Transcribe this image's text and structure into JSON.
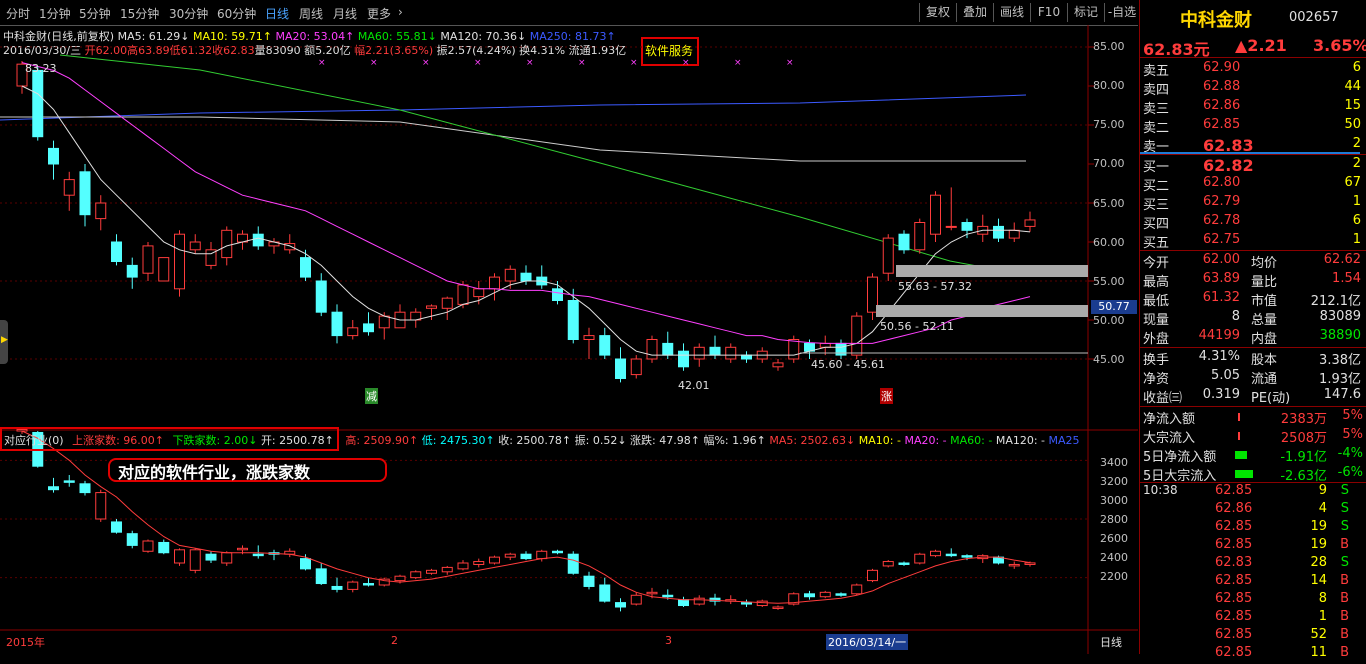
{
  "toolbar": {
    "tabs": [
      "分时",
      "1分钟",
      "5分钟",
      "15分钟",
      "30分钟",
      "60分钟",
      "日线",
      "周线",
      "月线",
      "更多"
    ],
    "active_tab": "日线",
    "buttons": [
      "复权",
      "叠加",
      "画线",
      "F10",
      "标记",
      "-自选"
    ]
  },
  "stock_info": {
    "name_line": "中科金财(日线,前复权)",
    "ma5": "MA5: 61.29↓",
    "ma10": "MA10: 59.71↑",
    "ma20": "MA20: 53.04↑",
    "ma60": "MA60: 55.81↓",
    "ma120": "MA120: 70.36↓",
    "ma250": "MA250: 81.73↑",
    "date": "2016/03/30/三",
    "open": "开62.00",
    "high": "高63.89",
    "low": "低61.32",
    "close": "收62.83",
    "volume": "量83090",
    "amount": "额5.20亿",
    "change": "幅2.21(3.65%)",
    "amplitude": "振2.57(4.24%)",
    "turnover": "换4.31%",
    "float": "流通1.93亿",
    "industry_tag": "软件服务"
  },
  "main_chart": {
    "y_ticks": [
      "85.00",
      "80.00",
      "75.00",
      "70.00",
      "65.00",
      "60.00",
      "55.00",
      "50.00",
      "45.00"
    ],
    "high_label": "83.23",
    "low_label": "42.01",
    "zone_labels": [
      "55.63 - 57.32",
      "50.56 - 52.11",
      "45.60 - 45.61"
    ],
    "price_marker": "50.77",
    "marker_down": "减",
    "marker_up": "涨"
  },
  "sub_info": {
    "label": "对应行业(0)",
    "up": "上涨家数: 96.00↑",
    "down": "下跌家数: 2.00↓",
    "open": "开: 2500.78↑",
    "high": "高: 2509.90↑",
    "low": "低: 2475.30↑",
    "close": "收: 2500.78↑",
    "amp": "振: 0.52↓",
    "change": "涨跌: 47.98↑",
    "pct": "幅%: 1.96↑",
    "ma5": "MA5: 2502.63↓",
    "ma10": "MA10: -",
    "ma20": "MA20: -",
    "ma60": "MA60: -",
    "ma120": "MA120: -",
    "ma250": "MA25"
  },
  "annotation": "对应的软件行业，涨跌家数",
  "sub_chart": {
    "y_ticks": [
      "3400",
      "3200",
      "3000",
      "2800",
      "2600",
      "2400",
      "2200"
    ]
  },
  "bottom_axis": {
    "labels": [
      "2015年",
      "2",
      "3",
      "2016/03/14/一"
    ],
    "period": "日线"
  },
  "quote_panel": {
    "title": "中科金财",
    "code": "002657",
    "price": "62.83元",
    "change": "▲2.21",
    "pct": "3.65%",
    "asks": [
      {
        "label": "卖五",
        "price": "62.90",
        "vol": "6"
      },
      {
        "label": "卖四",
        "price": "62.88",
        "vol": "44"
      },
      {
        "label": "卖三",
        "price": "62.86",
        "vol": "15"
      },
      {
        "label": "卖二",
        "price": "62.85",
        "vol": "50"
      },
      {
        "label": "卖一",
        "price": "62.83",
        "vol": "2"
      }
    ],
    "bids": [
      {
        "label": "买一",
        "price": "62.82",
        "vol": "2"
      },
      {
        "label": "买二",
        "price": "62.80",
        "vol": "67"
      },
      {
        "label": "买三",
        "price": "62.79",
        "vol": "1"
      },
      {
        "label": "买四",
        "price": "62.78",
        "vol": "6"
      },
      {
        "label": "买五",
        "price": "62.75",
        "vol": "1"
      }
    ],
    "stats": [
      {
        "l1": "今开",
        "v1": "62.00",
        "l2": "均价",
        "v2": "62.62"
      },
      {
        "l1": "最高",
        "v1": "63.89",
        "l2": "量比",
        "v2": "1.54"
      },
      {
        "l1": "最低",
        "v1": "61.32",
        "l2": "市值",
        "v2": "212.1亿"
      },
      {
        "l1": "现量",
        "v1": "8",
        "l2": "总量",
        "v2": "83089"
      },
      {
        "l1": "外盘",
        "v1": "44199",
        "l2": "内盘",
        "v2": "38890"
      }
    ],
    "stats2": [
      {
        "l1": "换手",
        "v1": "4.31%",
        "l2": "股本",
        "v2": "3.38亿"
      },
      {
        "l1": "净资",
        "v1": "5.05",
        "l2": "流通",
        "v2": "1.93亿"
      },
      {
        "l1": "收益㈢",
        "v1": "0.319",
        "l2": "PE(动)",
        "v2": "147.6"
      }
    ],
    "flows": [
      {
        "label": "净流入额",
        "value": "2383万",
        "pct": "5%",
        "bar": 0.02,
        "dir": "up"
      },
      {
        "label": "大宗流入",
        "value": "2508万",
        "pct": "5%",
        "bar": 0.02,
        "dir": "up"
      },
      {
        "label": "5日净流入额",
        "value": "-1.91亿",
        "pct": "-4%",
        "bar": 0.4,
        "dir": "down"
      },
      {
        "label": "5日大宗流入",
        "value": "-2.63亿",
        "pct": "-6%",
        "bar": 0.6,
        "dir": "down"
      }
    ],
    "time": "10:38",
    "ticks": [
      {
        "price": "62.85",
        "vol": "9",
        "bs": "S"
      },
      {
        "price": "62.86",
        "vol": "4",
        "bs": "S"
      },
      {
        "price": "62.85",
        "vol": "19",
        "bs": "S"
      },
      {
        "price": "62.85",
        "vol": "19",
        "bs": "B"
      },
      {
        "price": "62.83",
        "vol": "28",
        "bs": "S"
      },
      {
        "price": "62.85",
        "vol": "14",
        "bs": "B"
      },
      {
        "price": "62.85",
        "vol": "8",
        "bs": "B"
      },
      {
        "price": "62.85",
        "vol": "1",
        "bs": "B"
      },
      {
        "price": "62.85",
        "vol": "52",
        "bs": "B"
      },
      {
        "price": "62.85",
        "vol": "11",
        "bs": "B"
      }
    ]
  },
  "chart_data": {
    "type": "candlestick",
    "main": {
      "ohlc": [
        [
          80,
          83.2,
          79,
          82.8
        ],
        [
          82,
          82.5,
          73,
          73.5
        ],
        [
          72,
          73,
          68,
          70
        ],
        [
          66,
          69,
          64,
          68
        ],
        [
          69,
          70,
          62,
          63.5
        ],
        [
          63,
          66,
          61.5,
          65
        ],
        [
          60,
          61,
          57,
          57.5
        ],
        [
          57,
          58,
          54,
          55.5
        ],
        [
          56,
          60,
          55,
          59.5
        ],
        [
          55,
          58,
          55,
          58
        ],
        [
          54,
          61.5,
          53,
          61
        ],
        [
          59,
          61,
          58.5,
          60
        ],
        [
          57,
          60,
          56.5,
          59
        ],
        [
          58,
          62,
          57,
          61.5
        ],
        [
          60,
          61.5,
          59,
          61
        ],
        [
          61,
          62,
          59,
          59.5
        ],
        [
          59.5,
          60.5,
          58.5,
          60
        ],
        [
          59,
          61,
          58.5,
          59.8
        ],
        [
          58,
          59,
          55,
          55.5
        ],
        [
          55,
          56,
          50.5,
          51
        ],
        [
          51,
          52,
          47,
          48
        ],
        [
          48,
          50,
          47.5,
          49
        ],
        [
          49.5,
          51,
          48,
          48.5
        ],
        [
          49,
          51,
          47.5,
          50.5
        ],
        [
          49,
          52,
          49,
          51
        ],
        [
          50,
          51.5,
          49,
          51
        ],
        [
          51.5,
          52,
          50,
          51.8
        ],
        [
          51.5,
          53,
          50,
          52.8
        ],
        [
          52,
          55,
          51.5,
          54.5
        ],
        [
          53,
          55,
          52,
          54
        ],
        [
          54,
          56,
          52.5,
          55.5
        ],
        [
          55,
          57,
          54,
          56.5
        ],
        [
          56,
          57,
          54.5,
          55
        ],
        [
          55.5,
          57,
          54,
          54.5
        ],
        [
          54,
          55,
          52,
          52.5
        ],
        [
          52.5,
          54,
          47,
          47.5
        ],
        [
          47.5,
          49,
          45,
          48
        ],
        [
          48,
          49,
          45,
          45.5
        ],
        [
          45,
          46.5,
          42,
          42.5
        ],
        [
          43,
          45.5,
          42.5,
          45
        ],
        [
          45,
          48,
          44.5,
          47.5
        ],
        [
          47,
          48.5,
          45,
          45.5
        ],
        [
          46,
          47,
          43.5,
          44
        ],
        [
          45,
          47,
          44,
          46.5
        ],
        [
          46.5,
          48,
          45,
          45.5
        ],
        [
          45,
          47,
          44.5,
          46.5
        ],
        [
          45.5,
          46,
          44.5,
          45
        ],
        [
          45,
          46.5,
          44.5,
          46
        ],
        [
          44,
          45,
          43.5,
          44.5
        ],
        [
          45,
          48,
          44.5,
          47.5
        ],
        [
          47,
          47.5,
          45,
          46
        ],
        [
          46.5,
          48,
          45.5,
          47
        ],
        [
          47,
          47.5,
          45,
          45.5
        ],
        [
          45.5,
          51,
          45,
          50.5
        ],
        [
          51,
          56,
          50,
          55.5
        ],
        [
          56,
          61,
          55,
          60.5
        ],
        [
          61,
          61.5,
          58.5,
          59
        ],
        [
          59,
          63,
          58.5,
          62.5
        ],
        [
          61,
          66.5,
          60,
          66
        ],
        [
          62,
          67,
          61.5,
          62
        ],
        [
          62.5,
          63,
          60.5,
          61.5
        ],
        [
          61,
          63.5,
          60,
          62
        ],
        [
          62,
          63,
          60,
          60.5
        ],
        [
          60.5,
          62.5,
          60,
          61.5
        ],
        [
          62,
          63.89,
          61.32,
          62.83
        ]
      ],
      "ma5": [
        80,
        79,
        77,
        74,
        71,
        68,
        66,
        64,
        62,
        60,
        59,
        58.5,
        58.5,
        59.5,
        60,
        60.5,
        60,
        59.5,
        58.5,
        57,
        55,
        53,
        51.5,
        50.5,
        50,
        50,
        50.5,
        51,
        52,
        52.5,
        53.5,
        54.5,
        55,
        55,
        54.5,
        53,
        51.5,
        49.5,
        47.5,
        46,
        45.5,
        45.5,
        45.5,
        45.5,
        45.5,
        45.5,
        45.5,
        45.5,
        45.5,
        45.5,
        46,
        46.5,
        46.5,
        47,
        48.5,
        51,
        53.5,
        56,
        58.5,
        60,
        61,
        61.5,
        61.5,
        61.5,
        61.3
      ],
      "ma20": [
        83,
        82.5,
        82,
        81,
        79.5,
        78,
        76.5,
        75,
        73.5,
        72,
        70.5,
        69,
        68,
        67,
        66,
        65.5,
        65,
        64.5,
        64,
        63,
        62,
        61,
        60,
        59,
        58,
        57,
        56,
        55,
        54.5,
        54,
        54,
        53.8,
        53.8,
        53.8,
        53.5,
        53.2,
        53,
        52.5,
        52,
        51.5,
        51,
        50.5,
        50,
        49.5,
        49,
        48.5,
        48,
        48,
        47.5,
        47.3,
        47.1,
        47,
        47,
        47,
        47,
        47.5,
        48,
        48.5,
        49,
        50,
        50.5,
        51.5,
        52,
        52.5,
        53
      ]
    },
    "sub": {
      "ohlc": [
        [
          3400,
          3420,
          3380,
          3410
        ],
        [
          3390,
          3400,
          3150,
          3160
        ],
        [
          3020,
          3080,
          2980,
          3000
        ],
        [
          3060,
          3100,
          3020,
          3050
        ],
        [
          3040,
          3060,
          2960,
          2980
        ],
        [
          2800,
          3000,
          2780,
          2980
        ],
        [
          2780,
          2800,
          2700,
          2710
        ],
        [
          2700,
          2720,
          2600,
          2620
        ],
        [
          2580,
          2660,
          2570,
          2650
        ],
        [
          2640,
          2660,
          2560,
          2570
        ],
        [
          2500,
          2600,
          2480,
          2590
        ],
        [
          2450,
          2600,
          2430,
          2590
        ],
        [
          2560,
          2580,
          2500,
          2520
        ],
        [
          2500,
          2580,
          2480,
          2570
        ],
        [
          2590,
          2620,
          2560,
          2600
        ],
        [
          2560,
          2620,
          2530,
          2550
        ],
        [
          2570,
          2590,
          2520,
          2560
        ],
        [
          2560,
          2600,
          2540,
          2580
        ],
        [
          2530,
          2560,
          2450,
          2460
        ],
        [
          2460,
          2500,
          2350,
          2360
        ],
        [
          2340,
          2400,
          2300,
          2320
        ],
        [
          2320,
          2380,
          2300,
          2370
        ],
        [
          2360,
          2400,
          2340,
          2350
        ],
        [
          2350,
          2400,
          2340,
          2390
        ],
        [
          2380,
          2420,
          2360,
          2410
        ],
        [
          2400,
          2450,
          2390,
          2440
        ],
        [
          2430,
          2460,
          2420,
          2450
        ],
        [
          2440,
          2480,
          2420,
          2470
        ],
        [
          2460,
          2520,
          2450,
          2500
        ],
        [
          2490,
          2530,
          2470,
          2510
        ],
        [
          2500,
          2550,
          2490,
          2540
        ],
        [
          2540,
          2570,
          2520,
          2560
        ],
        [
          2560,
          2580,
          2520,
          2530
        ],
        [
          2530,
          2590,
          2510,
          2580
        ],
        [
          2580,
          2590,
          2560,
          2570
        ],
        [
          2560,
          2580,
          2420,
          2430
        ],
        [
          2410,
          2440,
          2320,
          2340
        ],
        [
          2350,
          2400,
          2230,
          2240
        ],
        [
          2230,
          2260,
          2170,
          2200
        ],
        [
          2220,
          2300,
          2210,
          2280
        ],
        [
          2290,
          2330,
          2260,
          2300
        ],
        [
          2280,
          2320,
          2250,
          2270
        ],
        [
          2250,
          2270,
          2200,
          2210
        ],
        [
          2220,
          2280,
          2210,
          2260
        ],
        [
          2260,
          2290,
          2210,
          2240
        ],
        [
          2240,
          2280,
          2220,
          2250
        ],
        [
          2230,
          2250,
          2200,
          2220
        ],
        [
          2210,
          2250,
          2200,
          2240
        ],
        [
          2190,
          2210,
          2180,
          2200
        ],
        [
          2220,
          2300,
          2210,
          2290
        ],
        [
          2290,
          2310,
          2250,
          2270
        ],
        [
          2270,
          2310,
          2260,
          2300
        ],
        [
          2290,
          2300,
          2270,
          2280
        ],
        [
          2290,
          2360,
          2280,
          2350
        ],
        [
          2380,
          2460,
          2370,
          2450
        ],
        [
          2480,
          2520,
          2470,
          2510
        ],
        [
          2500,
          2510,
          2480,
          2490
        ],
        [
          2500,
          2570,
          2490,
          2560
        ],
        [
          2550,
          2590,
          2540,
          2580
        ],
        [
          2560,
          2600,
          2540,
          2550
        ],
        [
          2550,
          2560,
          2520,
          2540
        ],
        [
          2530,
          2560,
          2500,
          2550
        ],
        [
          2540,
          2550,
          2490,
          2500
        ],
        [
          2480,
          2510,
          2460,
          2490
        ],
        [
          2490,
          2510,
          2475,
          2500.78
        ]
      ],
      "ma5": [
        3400,
        3350,
        3280,
        3200,
        3100,
        3020,
        2950,
        2850,
        2760,
        2680,
        2620,
        2600,
        2580,
        2570,
        2570,
        2570,
        2565,
        2560,
        2540,
        2500,
        2460,
        2430,
        2400,
        2380,
        2370,
        2380,
        2390,
        2410,
        2430,
        2450,
        2470,
        2490,
        2510,
        2530,
        2540,
        2520,
        2480,
        2420,
        2350,
        2300,
        2270,
        2260,
        2250,
        2250,
        2245,
        2240,
        2235,
        2230,
        2225,
        2230,
        2240,
        2250,
        2260,
        2280,
        2310,
        2360,
        2400,
        2440,
        2480,
        2510,
        2530,
        2540,
        2540,
        2520,
        2502.63
      ]
    }
  }
}
